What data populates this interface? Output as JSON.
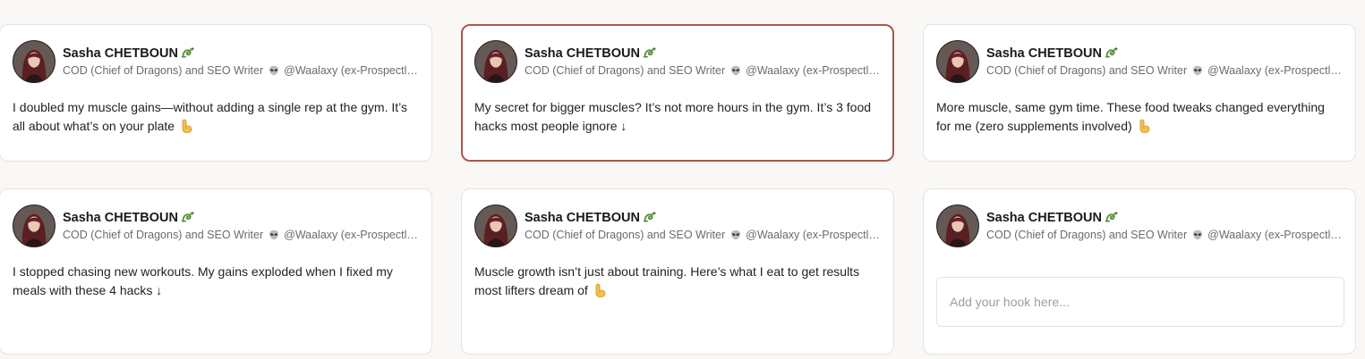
{
  "author": {
    "name": "Sasha CHETBOUN",
    "subtitle_before_icon": "COD (Chief of Dragons) and SEO Writer",
    "subtitle_after_icon": "@Waalaxy (ex-Prospectl…"
  },
  "icons": {
    "name_badge": "dragon-icon",
    "subtitle_badge": "alien-icon",
    "hook_end": [
      "pointing-down-icon",
      "arrow-down"
    ]
  },
  "accent_color": "#a8584a",
  "hooks": [
    {
      "text": "I doubled my muscle gains—without adding a single rep at the gym. It’s all about what’s on your plate",
      "ending": "pointing-down"
    },
    {
      "text": "My secret for bigger muscles? It’s not more hours in the gym. It’s 3 food hacks most people ignore ↓",
      "ending": "none",
      "selected": true
    },
    {
      "text": "More muscle, same gym time. These food tweaks changed everything for me (zero supplements involved)",
      "ending": "pointing-down"
    },
    {
      "text": "I stopped chasing new workouts. My gains exploded when I fixed my meals with these 4 hacks ↓",
      "ending": "none"
    },
    {
      "text": "Muscle growth isn’t just about training. Here’s what I eat to get results most lifters dream of",
      "ending": "pointing-down"
    }
  ],
  "new_hook": {
    "placeholder": "Add your hook here...",
    "value": ""
  }
}
